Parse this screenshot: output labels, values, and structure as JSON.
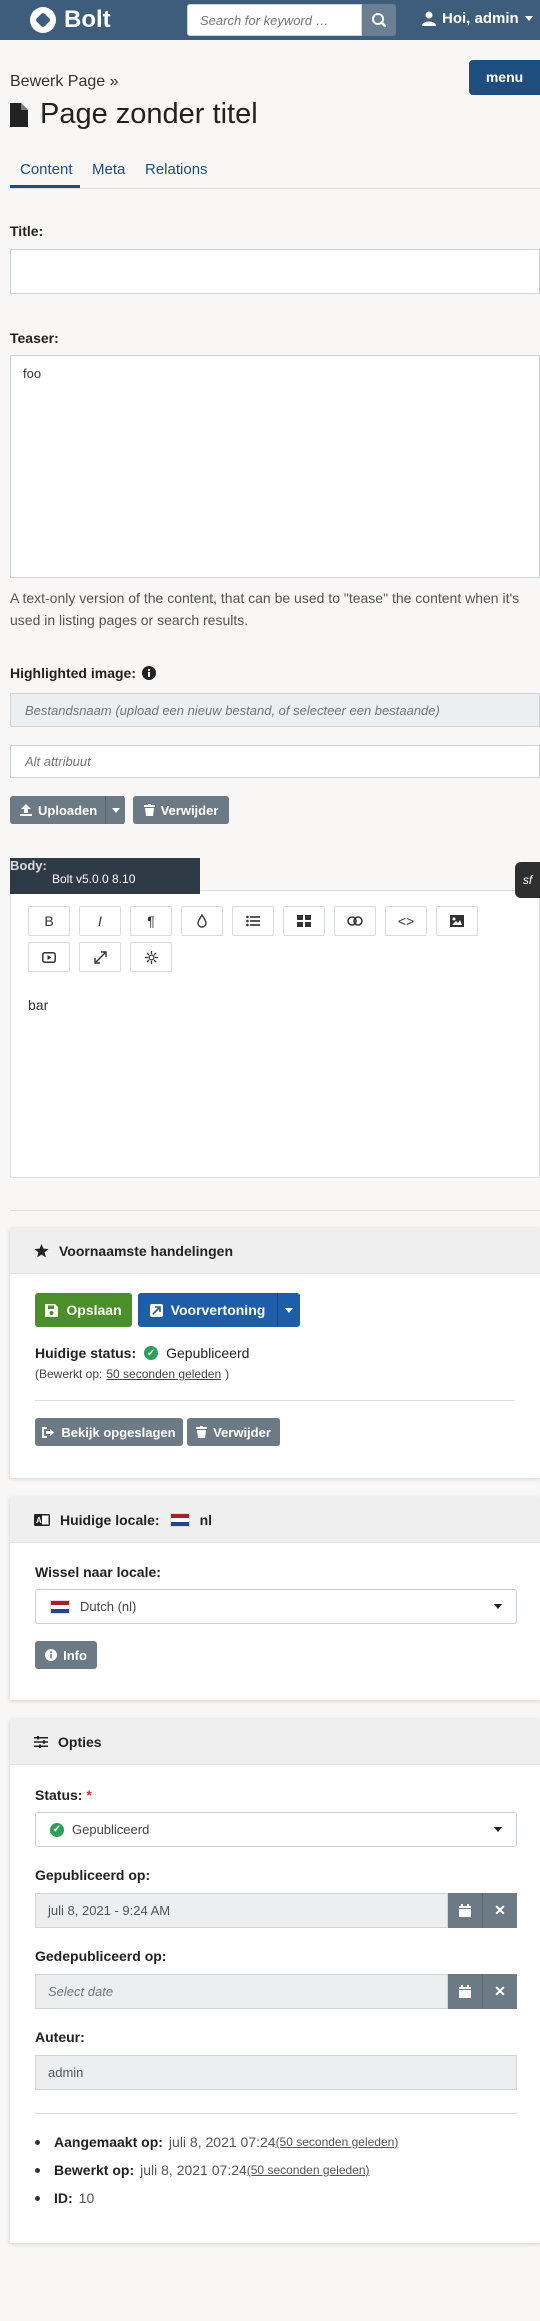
{
  "topbar": {
    "brand": "Bolt",
    "search_placeholder": "Search for keyword …",
    "user_label": "Hoi, admin"
  },
  "breadcrumb": "Bewerk Page »",
  "menu_label": "menu",
  "page_title": "Page zonder titel",
  "tabs": [
    {
      "label": "Content",
      "active": true
    },
    {
      "label": "Meta",
      "active": false
    },
    {
      "label": "Relations",
      "active": false
    }
  ],
  "fields": {
    "title_label": "Title:",
    "title_value": "",
    "teaser_label": "Teaser:",
    "teaser_value": "foo",
    "teaser_hint": "A text-only version of the content, that can be used to \"tease\" the content when it's used in listing pages or search results.",
    "image_label": "Highlighted image:",
    "image_filename_placeholder": "Bestandsnaam (upload een nieuw bestand, of selecteer een bestaande)",
    "image_alt_placeholder": "Alt attribuut",
    "upload_label": "Uploaden",
    "remove_label": "Verwijder",
    "body_label": "Body:",
    "body_value": "bar"
  },
  "debug_bar": "Bolt v5.0.0 8.10",
  "editor_toolbar": [
    "B",
    "I",
    "¶",
    "drop-icon",
    "bullet-list-icon",
    "table-icon",
    "link-icon",
    "<>",
    "image-icon",
    "video-icon",
    "fullscreen-icon",
    "asterisk-icon"
  ],
  "actions_card": {
    "title": "Voornaamste handelingen",
    "save_label": "Opslaan",
    "preview_label": "Voorvertoning",
    "status_label": "Huidige status:",
    "status_value": "Gepubliceerd",
    "edited_prefix": "(Bewerkt op:",
    "edited_relative": "50 seconden geleden",
    "edited_suffix": ")",
    "view_saved_label": "Bekijk opgeslagen",
    "delete_label": "Verwijder"
  },
  "locale_card": {
    "title": "Huidige locale:",
    "current": "nl",
    "switch_label": "Wissel naar locale:",
    "option": "Dutch (nl)",
    "info_label": "Info"
  },
  "options_card": {
    "title": "Opties",
    "status_label": "Status:",
    "required_mark": "*",
    "status_value": "Gepubliceerd",
    "published_label": "Gepubliceerd op:",
    "published_value": "juli 8, 2021 - 9:24 AM",
    "depublished_label": "Gedepubliceerd op:",
    "depublished_placeholder": "Select date",
    "author_label": "Auteur:",
    "author_value": "admin",
    "meta": [
      {
        "label": "Aangemaakt op:",
        "value": "juli 8, 2021 07:24",
        "relative": "(50 seconden geleden)"
      },
      {
        "label": "Bewerkt op:",
        "value": "juli 8, 2021 07:24",
        "relative": "(50 seconden geleden)"
      },
      {
        "label": "ID:",
        "value": "10",
        "relative": ""
      }
    ]
  },
  "colors": {
    "topbar": "#3e5d7c",
    "primary": "#1e4d80",
    "save": "#4a8f2a",
    "preview": "#1e5ea8",
    "grey_button": "#6c7a86"
  }
}
